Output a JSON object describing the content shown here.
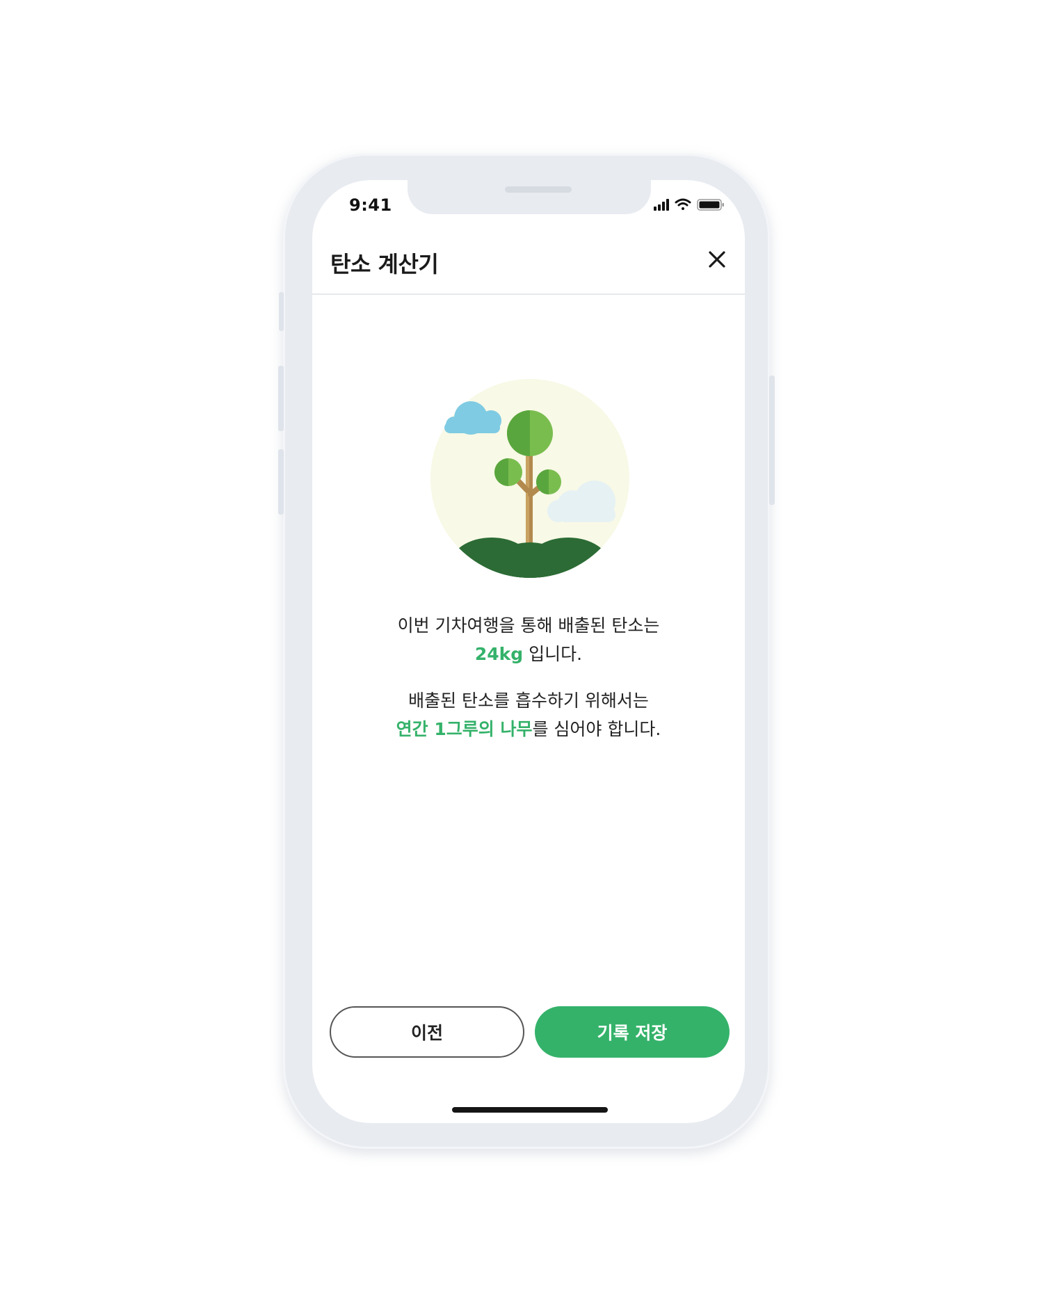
{
  "status_bar": {
    "time": "9:41",
    "icons": [
      "signal-icon",
      "wifi-icon",
      "battery-icon"
    ]
  },
  "header": {
    "title": "탄소 계산기",
    "close_icon": "close-icon"
  },
  "illustration": {
    "name": "tree-illustration",
    "colors": {
      "background_circle": "#f8f9e6",
      "leaf_light": "#7abd4f",
      "leaf_dark": "#5aa63e",
      "trunk": "#b38a4e",
      "ground": "#2c6b35",
      "cloud_blue": "#7fcbe3",
      "cloud_light": "#e6f1f4"
    }
  },
  "result": {
    "line1": "이번 기차여행을 통해 배출된 탄소는",
    "amount": "24kg",
    "line2_suffix": " 입니다.",
    "line3": "배출된 탄소를 흡수하기 위해서는",
    "trees": "연간 1그루의 나무",
    "line4_suffix": "를 심어야 합니다."
  },
  "buttons": {
    "prev_label": "이전",
    "save_label": "기록 저장"
  },
  "colors": {
    "accent": "#34b26a",
    "text": "#222222"
  }
}
